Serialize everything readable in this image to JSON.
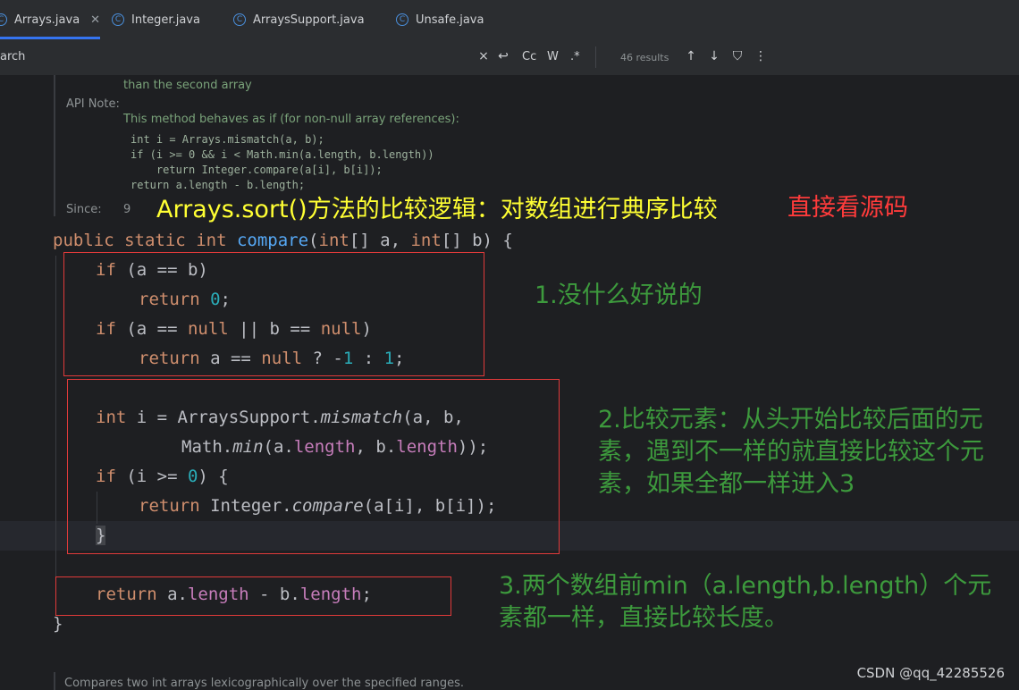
{
  "tabs": [
    {
      "label": "Arrays.java",
      "active": true
    },
    {
      "label": "Integer.java",
      "active": false
    },
    {
      "label": "ArraysSupport.java",
      "active": false
    },
    {
      "label": "Unsafe.java",
      "active": false
    }
  ],
  "search": {
    "label": "arch",
    "match_case": "Cc",
    "words": "W",
    "regex": ".*",
    "results": "46 results"
  },
  "javadoc": {
    "line1": "than the second array",
    "api_note_label": "API Note:",
    "api_note_text": "This method behaves as if (for non-null array references):",
    "code1": "int i = Arrays.mismatch(a, b);",
    "code2": "if (i >= 0 && i < Math.min(a.length, b.length))",
    "code3": "    return Integer.compare(a[i], b[i]);",
    "code4": "return a.length - b.length;",
    "since_label": "Since:",
    "since_value": "9",
    "bottom": "Compares two int arrays lexicographically over the specified ranges."
  },
  "code_tokens": {
    "public": "public",
    "static": "static",
    "int": "int",
    "compare": "compare",
    "paren_open": "(",
    "int2": "int",
    "arr_a": "[] a, ",
    "int3": "int",
    "arr_b": "[] b) {",
    "if": "if",
    "a_eq_b": " (a == b)",
    "return": "return",
    "zero": "0",
    "semi": ";",
    "if2": "if",
    "null_check_1": " (a == ",
    "null1": "null",
    "null_check_2": " || b == ",
    "null2": "null",
    "close_paren": ")",
    "return2": "return",
    "ternary_1": " a == ",
    "null3": "null",
    "ternary_2": " ? -",
    "one1": "1",
    "ternary_3": " : ",
    "one2": "1",
    "semi2": ";",
    "int4": "int",
    "i_assign": " i = ArraysSupport.",
    "mismatch": "mismatch",
    "mismatch_args": "(a, b,",
    "math": "Math.",
    "min": "min",
    "min_open": "(a.",
    "length1": "length",
    "comma_b": ", b.",
    "length2": "length",
    "min_close": "));",
    "if3": "if",
    "i_ge": " (i >= ",
    "zero2": "0",
    "brace_open": ") {",
    "return3": "return",
    "integer": " Integer.",
    "compare2": "compare",
    "compare_args": "(a[i], b[i]);",
    "brace_close": "}",
    "return4": "return",
    "ret_a": " a.",
    "length3": "length",
    "minus_b": " - b.",
    "length4": "length",
    "semi3": ";",
    "final_brace": "}"
  },
  "annotations": {
    "title": "Arrays.sort()方法的比较逻辑：对数组进行典序比较",
    "source_hint": "直接看源码",
    "note1": "1.没什么好说的",
    "note2_line1": "2.比较元素：从头开始比较后面的元",
    "note2_line2": "素，遇到不一样的就直接比较这个元",
    "note2_line3": "素，如果全都一样进入3",
    "note3_line1": "3.两个数组前min（a.length,b.length）个元",
    "note3_line2": "素都一样，直接比较长度。"
  },
  "watermark": "CSDN @qq_42285526",
  "colors": {
    "background": "#1e1f22",
    "keyword": "#cf8e6d",
    "function": "#56a8f5",
    "number": "#2aacb8",
    "field": "#c77dbb",
    "annotation_yellow": "#ffff33",
    "annotation_red": "#ff3b3b",
    "annotation_green": "#3d9a3d",
    "box_red": "#e03a3a",
    "tab_accent": "#3574f0"
  }
}
